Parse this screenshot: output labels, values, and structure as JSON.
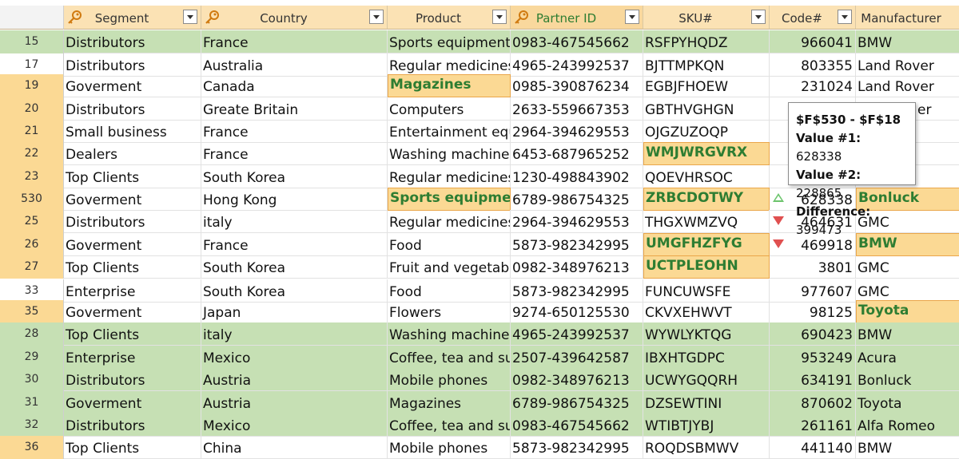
{
  "columns": [
    {
      "key": "segment",
      "label": "Segment",
      "key_icon": true
    },
    {
      "key": "country",
      "label": "Country",
      "key_icon": true
    },
    {
      "key": "product",
      "label": "Product",
      "key_icon": false
    },
    {
      "key": "partner",
      "label": "Partner ID",
      "key_icon": true,
      "selected": true
    },
    {
      "key": "sku",
      "label": "SKU#",
      "key_icon": false
    },
    {
      "key": "code",
      "label": "Code#",
      "key_icon": false
    },
    {
      "key": "manufacturer",
      "label": "Manufacturer",
      "key_icon": false
    }
  ],
  "colors": {
    "row_green": "#c6e0b4",
    "row_orange_num": "#fbd994",
    "highlight_text": "#2e7d32"
  },
  "rows": [
    {
      "num": "15",
      "segment": "Distributors",
      "country": "France",
      "product": "Sports equipment",
      "partner": "0983-467545662",
      "sku": "RSFPYHQDZ",
      "code": "966041",
      "manufacturer": "BMW",
      "band": "green",
      "numtone": "green"
    },
    {
      "num": "17",
      "segment": "Distributors",
      "country": "Australia",
      "product": "Regular medicines",
      "partner": "4965-243992537",
      "sku": "BJTTMPKQN",
      "code": "803355",
      "manufacturer": "Land Rover",
      "band": "none",
      "numtone": "plain"
    },
    {
      "num": "19",
      "segment": "Goverment",
      "country": "Canada",
      "product": "Magazines",
      "partner": "0985-390876234",
      "sku": "EGBJFHOEW",
      "code": "231024",
      "manufacturer": "Land Rover",
      "band": "none",
      "numtone": "orange",
      "hl": [
        "product"
      ]
    },
    {
      "num": "20",
      "segment": "Distributors",
      "country": "Greate Britain",
      "product": "Computers",
      "partner": "2633-559667353",
      "sku": "GBTHVGHGN",
      "code": "",
      "manufacturer": "",
      "band": "none",
      "numtone": "orange"
    },
    {
      "num": "21",
      "segment": "Small business",
      "country": "France",
      "product": "Entertainment equ",
      "partner": "2964-394629553",
      "sku": "OJGZUZOQP",
      "code": "",
      "manufacturer": "",
      "band": "none",
      "numtone": "orange"
    },
    {
      "num": "22",
      "segment": "Dealers",
      "country": "France",
      "product": "Washing machines",
      "partner": "6453-687965252",
      "sku": "WMJWRGVRX",
      "code": "",
      "manufacturer": "",
      "band": "none",
      "numtone": "orange",
      "hl": [
        "sku"
      ]
    },
    {
      "num": "23",
      "segment": "Top Clients",
      "country": "South Korea",
      "product": "Regular medicines",
      "partner": "1230-498843902",
      "sku": "QOEVHRSOC",
      "code": "",
      "manufacturer": "",
      "band": "none",
      "numtone": "orange"
    },
    {
      "num": "530",
      "segment": "Goverment",
      "country": "Hong Kong",
      "product": "Sports equipment",
      "partner": "6789-986754325",
      "sku": "ZRBCDOTWY",
      "code": "628338",
      "manufacturer": "Bonluck",
      "band": "none",
      "numtone": "orange",
      "hl": [
        "product",
        "sku",
        "manufacturer"
      ],
      "trend": "up"
    },
    {
      "num": "25",
      "segment": "Distributors",
      "country": "italy",
      "product": "Regular medicines",
      "partner": "2964-394629553",
      "sku": "THGXWMZVQ",
      "code": "464631",
      "manufacturer": "GMC",
      "band": "none",
      "numtone": "orange",
      "trend": "down"
    },
    {
      "num": "26",
      "segment": "Goverment",
      "country": "France",
      "product": "Food",
      "partner": "5873-982342995",
      "sku": "UMGFHZFYG",
      "code": "469918",
      "manufacturer": "BMW",
      "band": "none",
      "numtone": "orange",
      "hl": [
        "sku",
        "manufacturer"
      ],
      "trend": "down"
    },
    {
      "num": "27",
      "segment": "Top Clients",
      "country": "South Korea",
      "product": "Fruit and vegetabl",
      "partner": "0982-348976213",
      "sku": "UCTPLEOHN",
      "code": "3801",
      "manufacturer": "GMC",
      "band": "none",
      "numtone": "orange",
      "hl": [
        "sku"
      ]
    },
    {
      "num": "33",
      "segment": "Enterprise",
      "country": "South Korea",
      "product": "Food",
      "partner": "5873-982342995",
      "sku": "FUNCUWSFE",
      "code": "977607",
      "manufacturer": "GMC",
      "band": "none",
      "numtone": "plain"
    },
    {
      "num": "35",
      "segment": "Goverment",
      "country": "Japan",
      "product": "Flowers",
      "partner": "9274-650125530",
      "sku": "CKVXEHWVT",
      "code": "98125",
      "manufacturer": "Toyota",
      "band": "none",
      "numtone": "orange",
      "hl": [
        "manufacturer"
      ]
    },
    {
      "num": "28",
      "segment": "Top Clients",
      "country": "italy",
      "product": "Washing machines",
      "partner": "4965-243992537",
      "sku": "WYWLYKTQG",
      "code": "690423",
      "manufacturer": "BMW",
      "band": "green",
      "numtone": "green"
    },
    {
      "num": "29",
      "segment": "Enterprise",
      "country": "Mexico",
      "product": "Coffee, tea and su",
      "partner": "2507-439642587",
      "sku": "IBXHTGDPC",
      "code": "953249",
      "manufacturer": "Acura",
      "band": "green",
      "numtone": "green"
    },
    {
      "num": "30",
      "segment": "Distributors",
      "country": "Austria",
      "product": "Mobile phones",
      "partner": "0982-348976213",
      "sku": "UCWYGQQRH",
      "code": "634191",
      "manufacturer": "Bonluck",
      "band": "green",
      "numtone": "green"
    },
    {
      "num": "31",
      "segment": "Goverment",
      "country": "Austria",
      "product": "Magazines",
      "partner": "6789-986754325",
      "sku": "DZSEWTINI",
      "code": "870602",
      "manufacturer": "Toyota",
      "band": "green",
      "numtone": "green"
    },
    {
      "num": "32",
      "segment": "Distributors",
      "country": "Mexico",
      "product": "Coffee, tea and su",
      "partner": "0983-467545662",
      "sku": "WTIBTJYBJ",
      "code": "261161",
      "manufacturer": "Alfa Romeo",
      "band": "green",
      "numtone": "green"
    },
    {
      "num": "36",
      "segment": "Top Clients",
      "country": "China",
      "product": "Mobile phones",
      "partner": "5873-982342995",
      "sku": "ROQDSBMWV",
      "code": "441140",
      "manufacturer": "BMW",
      "band": "none",
      "numtone": "orange"
    }
  ],
  "tooltip": {
    "title": "$F$530 - $F$18",
    "v1_label": "Value #1:",
    "v1": "628338",
    "v2_label": "Value #2:",
    "v2": "228865",
    "diff_label": "Difference:",
    "diff": "399473"
  },
  "peek": {
    "manufacturer_row20_fragment": "er",
    "manufacturer_row21_fragment": "r"
  }
}
